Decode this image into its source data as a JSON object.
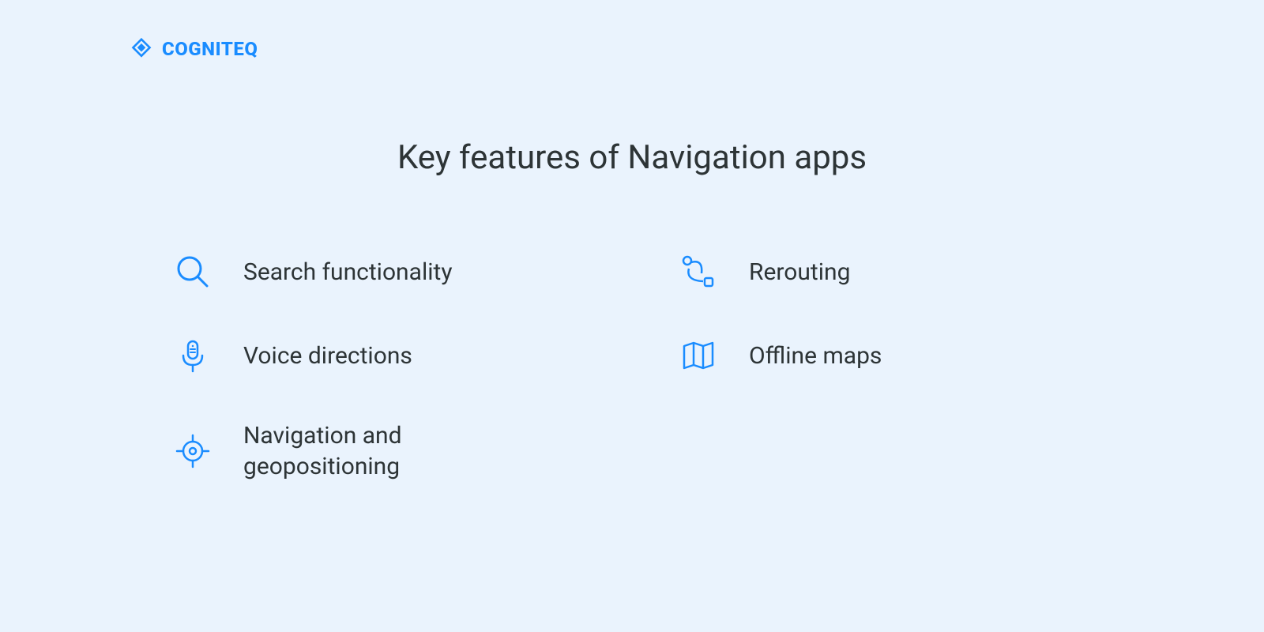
{
  "brand": {
    "name": "COGNITEQ"
  },
  "title": "Key features of Navigation apps",
  "features": {
    "search": "Search functionality",
    "rerouting": "Rerouting",
    "voice": "Voice directions",
    "offline": "Offline maps",
    "navigation": "Navigation and geopositioning"
  },
  "colors": {
    "accent": "#1a8cff",
    "background": "#eaf3fd",
    "text": "#2d3436"
  }
}
